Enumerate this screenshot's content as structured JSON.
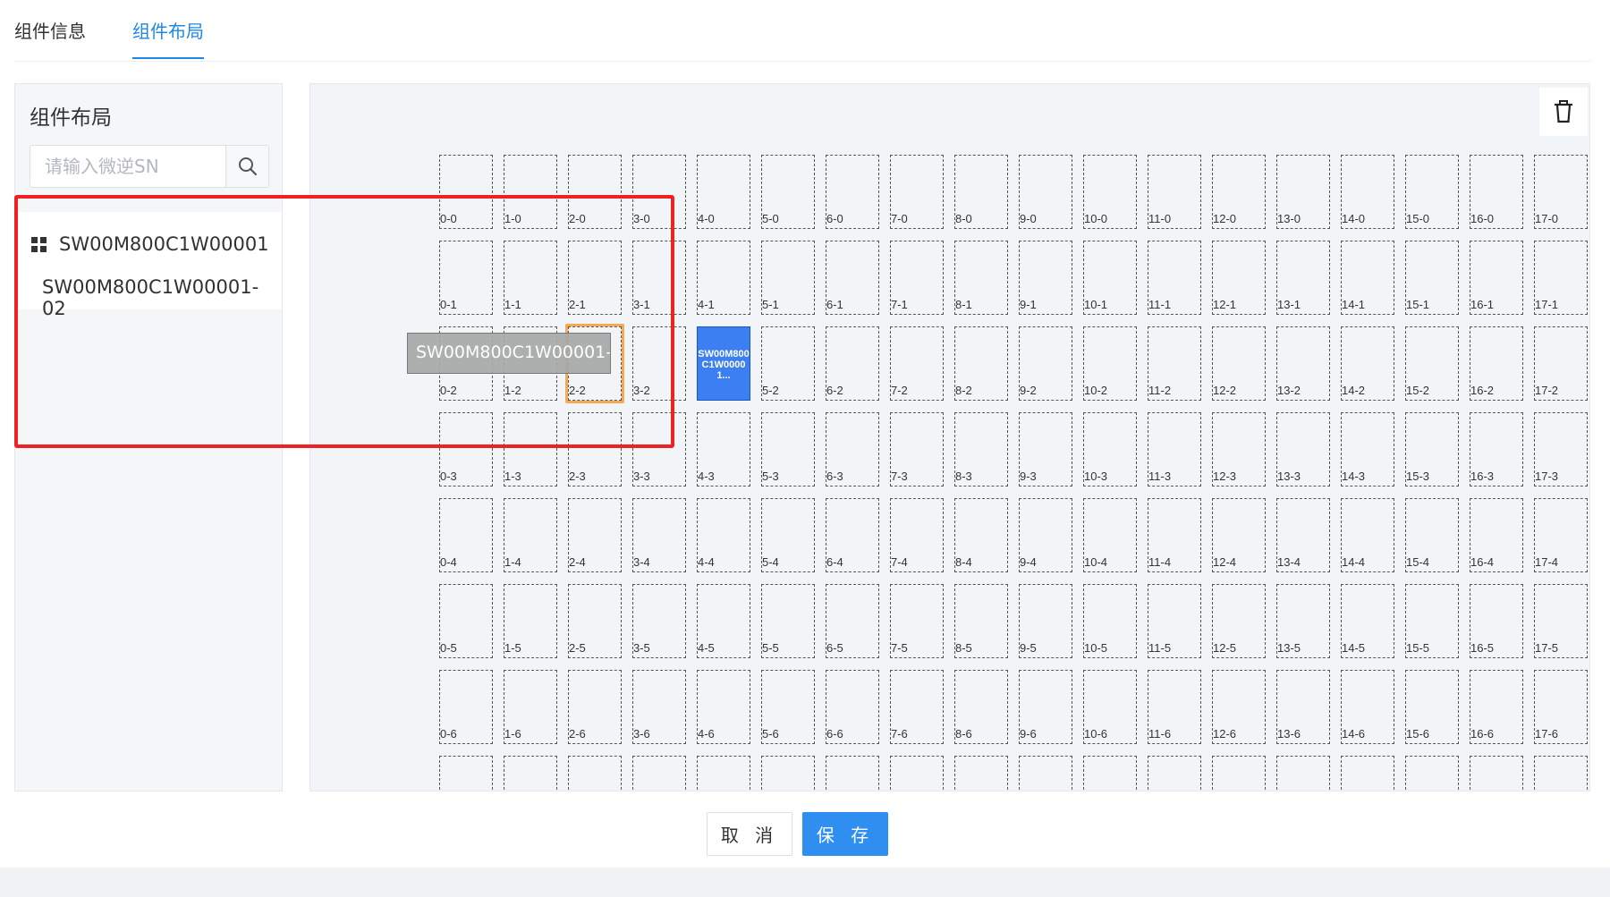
{
  "tabs": [
    {
      "label": "组件信息",
      "active": false
    },
    {
      "label": "组件布局",
      "active": true
    }
  ],
  "sidebar": {
    "title": "组件布局",
    "search": {
      "placeholder": "请输入微逆SN",
      "value": ""
    },
    "tree": {
      "root": "SW00M800C1W00001",
      "children": [
        "SW00M800C1W00001-02"
      ]
    }
  },
  "canvas": {
    "columns": 18,
    "rows": 8,
    "cell_labels_visible_rows": 7,
    "placed_component": {
      "cell": "4-2",
      "label": "SW00M800C1W00001..."
    },
    "drag_target_cell": "2-2",
    "drag_ghost_label": "SW00M800C1W00001-..."
  },
  "footer": {
    "cancel_label": "取 消",
    "save_label": "保 存"
  },
  "colors": {
    "accent": "#1e88e5",
    "placed": "#3b7ff2",
    "target_outline": "#f5a955",
    "annotation": "#ee2222"
  }
}
